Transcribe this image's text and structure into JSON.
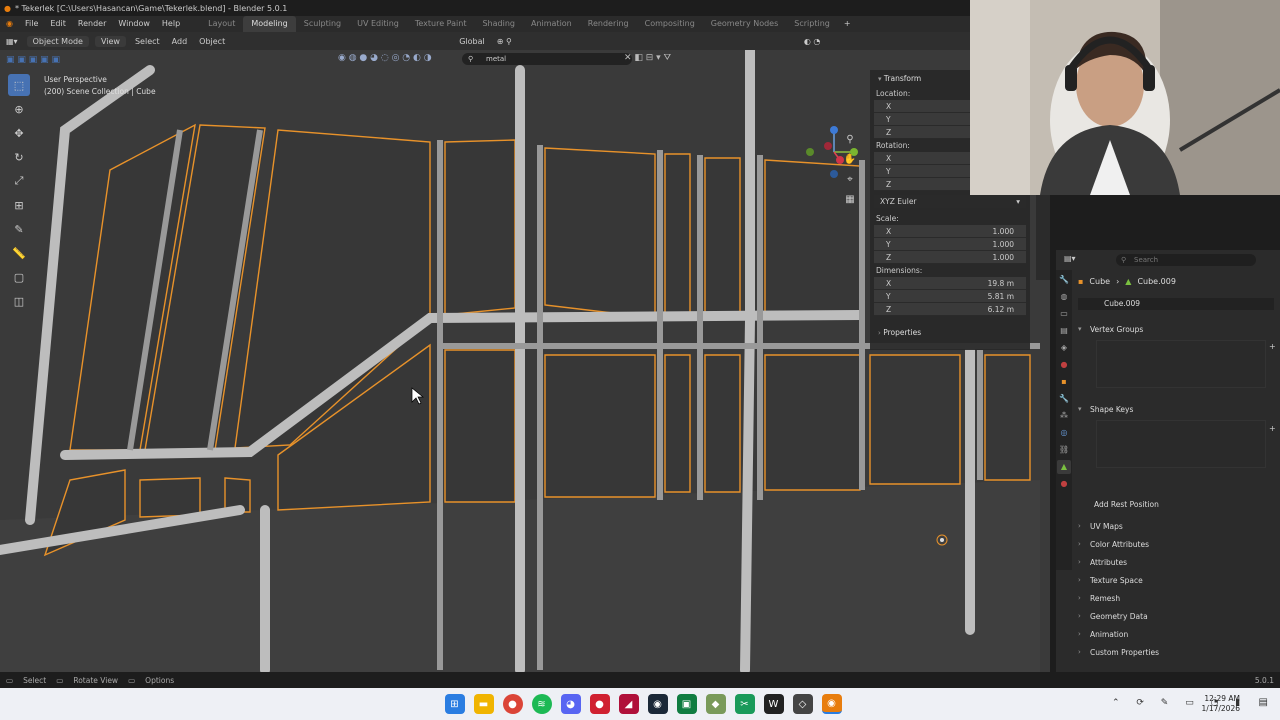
{
  "window": {
    "title": "* Tekerlek [C:\\Users\\Hasancan\\Game\\Tekerlek.blend] - Blender 5.0.1"
  },
  "menu": {
    "items": [
      "File",
      "Edit",
      "Render",
      "Window",
      "Help"
    ]
  },
  "workspaces": [
    "Layout",
    "Modeling",
    "Sculpting",
    "UV Editing",
    "Texture Paint",
    "Shading",
    "Animation",
    "Rendering",
    "Compositing",
    "Geometry Nodes",
    "Scripting"
  ],
  "active_workspace": "Modeling",
  "header": {
    "mode": "Object Mode",
    "view": "View",
    "select": "Select",
    "add": "Add",
    "object": "Object",
    "orientation": "Global"
  },
  "viewport": {
    "perspective": "User Perspective",
    "collection": "(200) Scene Collection | Cube",
    "search_value": "metal"
  },
  "transform": {
    "title": "Transform",
    "location_label": "Location:",
    "rotation_label": "Rotation:",
    "rotation_mode": "XYZ Euler",
    "scale_label": "Scale:",
    "scale": [
      "1.000",
      "1.000",
      "1.000"
    ],
    "dimensions_label": "Dimensions:",
    "dimensions": [
      "19.8 m",
      "5.81 m",
      "6.12 m"
    ],
    "axes": [
      "X",
      "Y",
      "Z"
    ],
    "properties": "Properties"
  },
  "properties": {
    "search_placeholder": "Search",
    "object": "Cube",
    "mesh": "Cube.009",
    "mesh_field": "Cube.009",
    "panels": {
      "vertex_groups": "Vertex Groups",
      "shape_keys": "Shape Keys",
      "add_rest": "Add Rest Position",
      "uv_maps": "UV Maps",
      "color_attributes": "Color Attributes",
      "attributes": "Attributes",
      "texture_space": "Texture Space",
      "remesh": "Remesh",
      "geometry_data": "Geometry Data",
      "animation": "Animation",
      "custom_properties": "Custom Properties"
    }
  },
  "status": {
    "select": "Select",
    "rotate": "Rotate View",
    "options": "Options",
    "version": "5.0.1"
  },
  "taskbar": {
    "time": "12:29 AM",
    "date": "1/17/2026"
  },
  "colors": {
    "selection_outline": "#e8922a",
    "active_tool": "#4772b3",
    "viewport_bg": "#3b3b3b"
  }
}
